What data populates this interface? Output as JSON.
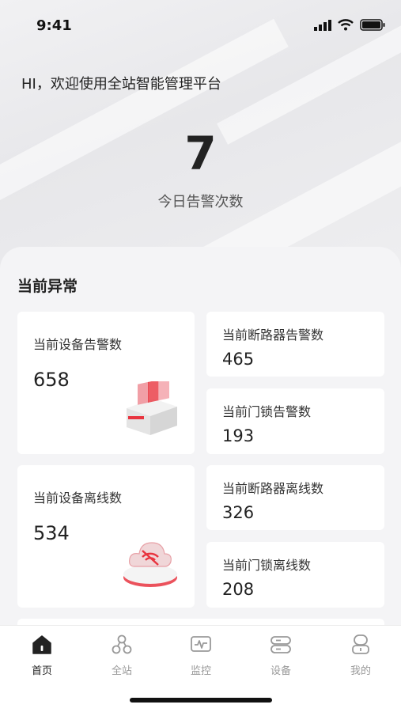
{
  "status_bar": {
    "time": "9:41"
  },
  "header": {
    "greeting": "HI，欢迎使用全站智能管理平台",
    "alarm_count": "7",
    "alarm_label": "今日告警次数"
  },
  "section": {
    "title": "当前异常",
    "cards": [
      {
        "label": "当前设备告警数",
        "value": "658",
        "illustration": "device-alarm-icon"
      },
      {
        "label": "当前断路器告警数",
        "value": "465"
      },
      {
        "label": "当前门锁告警数",
        "value": "193"
      },
      {
        "label": "当前设备离线数",
        "value": "534",
        "illustration": "device-offline-icon"
      },
      {
        "label": "当前断路器离线数",
        "value": "326"
      },
      {
        "label": "当前门锁离线数",
        "value": "208"
      }
    ]
  },
  "tab_bar": {
    "items": [
      {
        "label": "首页",
        "icon": "home-icon",
        "active": true
      },
      {
        "label": "全站",
        "icon": "network-icon",
        "active": false
      },
      {
        "label": "监控",
        "icon": "monitor-icon",
        "active": false
      },
      {
        "label": "设备",
        "icon": "device-icon",
        "active": false
      },
      {
        "label": "我的",
        "icon": "user-icon",
        "active": false
      }
    ]
  },
  "colors": {
    "accent": "#e8343f",
    "active_tab": "#222222",
    "inactive_tab": "#999999"
  }
}
